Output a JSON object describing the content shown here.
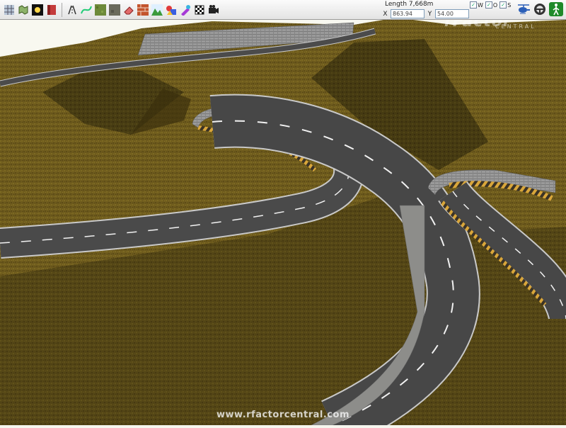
{
  "toolbar": {
    "tools": [
      {
        "name": "terrain-grid-icon"
      },
      {
        "name": "map-outline-icon"
      },
      {
        "name": "sun-lighting-icon"
      },
      {
        "name": "red-texture-icon"
      },
      {
        "name": "road-spline-icon"
      },
      {
        "name": "curve-tool-icon"
      },
      {
        "name": "grass-texture-icon"
      },
      {
        "name": "rock-texture-icon"
      },
      {
        "name": "eraser-icon"
      },
      {
        "name": "brick-wall-icon"
      },
      {
        "name": "landscape-icon"
      },
      {
        "name": "objects-icon"
      },
      {
        "name": "paint-icon"
      },
      {
        "name": "checkered-flag-icon"
      },
      {
        "name": "camera-icon"
      }
    ],
    "length_label": "Length 7,668m",
    "x_label": "X",
    "x_value": "863.94",
    "y_label": "Y",
    "y_value": "54.00",
    "checks": [
      {
        "label": "W",
        "checked": true
      },
      {
        "label": "O",
        "checked": true
      },
      {
        "label": "S",
        "checked": true
      }
    ]
  },
  "watermark": {
    "logo": "rFactor",
    "sub": "CENTRAL",
    "url": "www.rfactorcentral.com"
  },
  "colors": {
    "grass": "#6b5a1c",
    "asphalt": "#4a4a4a",
    "sky": "#f8f8f0"
  }
}
